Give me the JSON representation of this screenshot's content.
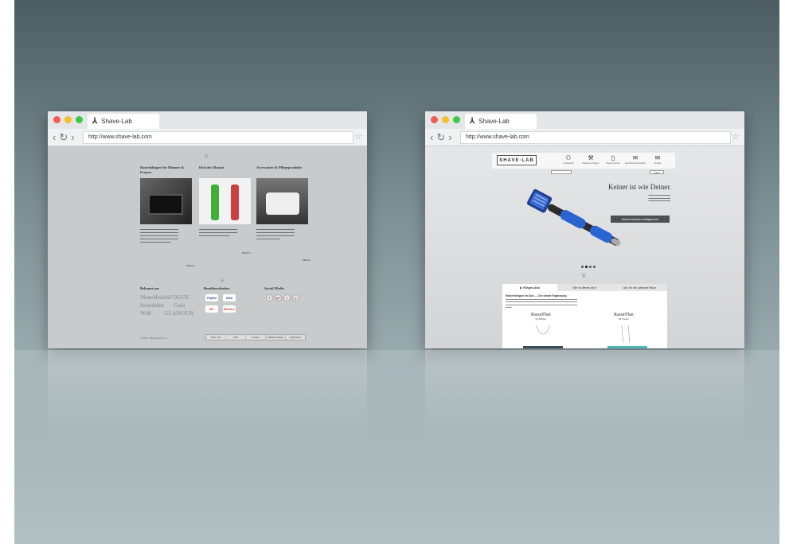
{
  "browsers": [
    {
      "tab_title": "Shave-Lab",
      "url": "http://www.shave-lab.com"
    },
    {
      "tab_title": "Shave-Lab",
      "url": "http://www.shave-lab.com"
    }
  ],
  "left_page": {
    "columns": [
      {
        "title": "Rasierklingen für Männer & Frauen",
        "more": "MEHR >"
      },
      {
        "title": "Deal des Monats",
        "more": "MEHR >"
      },
      {
        "title": "Accessoires & Pflegeprodukte",
        "more": "MEHR >"
      }
    ],
    "press_title": "Bekannt aus",
    "press_logos": [
      "MensHealth",
      "VOGUE",
      "brandeins",
      "Gala",
      "Welt",
      "GLAMOUR"
    ],
    "payment_title": "Bezahlmethoden",
    "payments": [
      "PayPal",
      "VISA",
      "MC",
      "Maestro"
    ],
    "social_title": "Social Media",
    "social": [
      "f",
      "g+",
      "t",
      "p"
    ],
    "copyright": "© 2014 - Shave-Lab.com",
    "footer_nav": [
      "Über uns",
      "Jobs",
      "Presse",
      "Häufige Fragen",
      "Impressum"
    ]
  },
  "right_page": {
    "logo": "SHAVE·LAB",
    "nav": [
      {
        "icon": "user-plus-icon",
        "glyph": "⚇",
        "label": "Konfigurator"
      },
      {
        "icon": "tools-icon",
        "glyph": "⚒",
        "label": "Rasierer & Klingen"
      },
      {
        "icon": "brush-icon",
        "glyph": "▯",
        "label": "Pflege & Schutz"
      },
      {
        "icon": "gift-icon",
        "glyph": "✉",
        "label": "Geschenke & Angebote"
      },
      {
        "icon": "mail-icon",
        "glyph": "✉",
        "label": "Kontakt"
      }
    ],
    "login": "Login",
    "headline": "Keiner ist wie Deiner.",
    "cta": "Deinen Rasierer konfigurieren",
    "tabs": [
      "Klingen-Abo",
      "Wie ist dieses Abo?",
      "Abo für die optimale Rasur"
    ],
    "panel_title": "Rasierklingen im Abo — Die ideale Ergänzung",
    "plans": [
      {
        "name": "RasurPlan",
        "for": "für Männer",
        "accent": "#3b4b57"
      },
      {
        "name": "RasurPlan",
        "for": "für Frauen",
        "accent": "#4fb8b4"
      }
    ]
  }
}
